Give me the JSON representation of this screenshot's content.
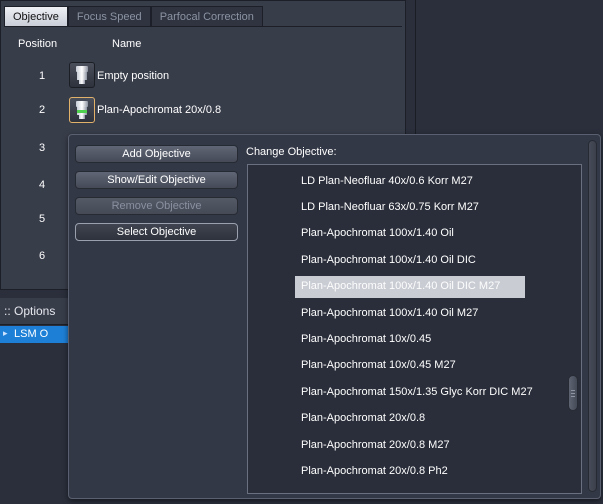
{
  "tabs": [
    {
      "label": "Objective",
      "active": true
    },
    {
      "label": "Focus Speed",
      "active": false
    },
    {
      "label": "Parfocal Correction",
      "active": false
    }
  ],
  "table": {
    "col_position": "Position",
    "col_name": "Name",
    "positions": [
      "1",
      "2",
      "3",
      "4",
      "5",
      "6"
    ],
    "row1_name": "Empty position",
    "row2_name": "Plan-Apochromat 20x/0.8"
  },
  "options": {
    "header": ":: Options",
    "item": "LSM O"
  },
  "popup": {
    "buttons": {
      "add": "Add Objective",
      "show_edit": "Show/Edit Objective",
      "remove": "Remove Objective",
      "select": "Select Objective"
    },
    "list_label": "Change Objective:",
    "selected_item": "Plan-Apochromat 100x/1.40 Oil DIC M27",
    "items": [
      "LD Plan-Neofluar 40x/0.6 Korr M27",
      "LD Plan-Neofluar 63x/0.75 Korr M27",
      "Plan-Apochromat 100x/1.40 Oil",
      "Plan-Apochromat 100x/1.40 Oil DIC",
      "Plan-Apochromat 100x/1.40 Oil DIC M27",
      "Plan-Apochromat 100x/1.40 Oil M27",
      "Plan-Apochromat 10x/0.45",
      "Plan-Apochromat 10x/0.45 M27",
      "Plan-Apochromat 150x/1.35 Glyc Korr DIC M27",
      "Plan-Apochromat 20x/0.8",
      "Plan-Apochromat 20x/0.8 M27",
      "Plan-Apochromat 20x/0.8 Ph2"
    ]
  },
  "colors": {
    "selection": "#c9ccd3",
    "accent_blue": "#1e7fd7",
    "icon_highlight": "#e3b26a",
    "objective_band": "#4fd04f"
  },
  "icons": {
    "objective": "objective-lens-icon",
    "selected_objective": "objective-lens-green-icon"
  }
}
